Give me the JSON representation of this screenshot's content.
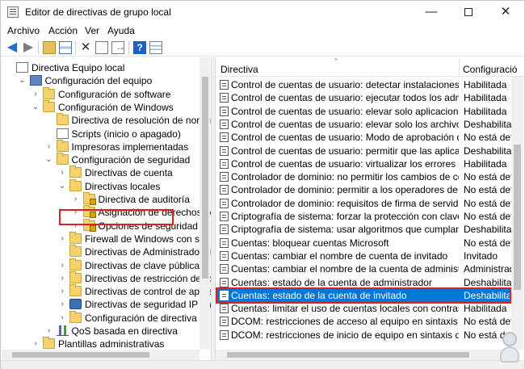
{
  "window": {
    "title": "Editor de directivas de grupo local",
    "controls": {
      "minimize": "—",
      "close": "✕"
    }
  },
  "menu": [
    "Archivo",
    "Acción",
    "Ver",
    "Ayuda"
  ],
  "toolbar": {
    "icons": [
      "back-icon",
      "forward-icon",
      "up-folder-icon",
      "show-hide-tree-icon",
      "delete-icon",
      "properties-icon",
      "export-list-icon",
      "help-icon",
      "filter-view-icon"
    ]
  },
  "tree": {
    "items": [
      {
        "label": "Directiva Equipo local",
        "icon": "document",
        "depth": 0,
        "expander": ""
      },
      {
        "label": "Configuración del equipo",
        "icon": "computer",
        "depth": 1,
        "expander": "open"
      },
      {
        "label": "Configuración de software",
        "icon": "folder",
        "depth": 2,
        "expander": "closed"
      },
      {
        "label": "Configuración de Windows",
        "icon": "folder",
        "depth": 2,
        "expander": "open"
      },
      {
        "label": "Directiva de resolución de nombres",
        "icon": "folder",
        "depth": 3,
        "expander": ""
      },
      {
        "label": "Scripts (inicio o apagado)",
        "icon": "document",
        "depth": 3,
        "expander": ""
      },
      {
        "label": "Impresoras implementadas",
        "icon": "folder",
        "depth": 3,
        "expander": "closed"
      },
      {
        "label": "Configuración de seguridad",
        "icon": "folder",
        "depth": 3,
        "expander": "open"
      },
      {
        "label": "Directivas de cuenta",
        "icon": "folder",
        "depth": 4,
        "expander": "closed"
      },
      {
        "label": "Directivas locales",
        "icon": "folder",
        "depth": 4,
        "expander": "open"
      },
      {
        "label": "Directiva de auditoría",
        "icon": "folder-lock",
        "depth": 5,
        "expander": "closed"
      },
      {
        "label": "Asignación de derechos de usu",
        "icon": "folder-lock",
        "depth": 5,
        "expander": "closed"
      },
      {
        "label": "Opciones de seguridad",
        "icon": "folder-lock",
        "depth": 5,
        "expander": "closed",
        "highlighted": true
      },
      {
        "label": "Firewall de Windows con segurida",
        "icon": "folder",
        "depth": 4,
        "expander": "closed"
      },
      {
        "label": "Directivas de Administrador de list",
        "icon": "folder",
        "depth": 4,
        "expander": ""
      },
      {
        "label": "Directivas de clave pública",
        "icon": "folder",
        "depth": 4,
        "expander": "closed"
      },
      {
        "label": "Directivas de restricción de softwa",
        "icon": "folder",
        "depth": 4,
        "expander": "closed"
      },
      {
        "label": "Directivas de control de aplicacion",
        "icon": "folder",
        "depth": 4,
        "expander": "closed"
      },
      {
        "label": "Directivas de seguridad IP en Equip",
        "icon": "shield",
        "depth": 4,
        "expander": "closed"
      },
      {
        "label": "Configuración de directiva de audi",
        "icon": "folder",
        "depth": 4,
        "expander": "closed"
      },
      {
        "label": "QoS basada en directiva",
        "icon": "chart",
        "depth": 3,
        "expander": "closed"
      },
      {
        "label": "Plantillas administrativas",
        "icon": "folder",
        "depth": 2,
        "expander": "closed"
      }
    ]
  },
  "list": {
    "columns": [
      "Directiva",
      "Configuració"
    ],
    "rows": [
      {
        "policy": "Control de cuentas de usuario: detectar instalaciones de apli...",
        "setting": "Habilitada"
      },
      {
        "policy": "Control de cuentas de usuario: ejecutar todos los administra...",
        "setting": "Habilitada"
      },
      {
        "policy": "Control de cuentas de usuario: elevar solo aplicaciones UIAc...",
        "setting": "Habilitada"
      },
      {
        "policy": "Control de cuentas de usuario: elevar solo los archivos ejecu...",
        "setting": "Deshabilitada"
      },
      {
        "policy": "Control de cuentas de usuario: Modo de aprobación de ad...",
        "setting": "No está defin"
      },
      {
        "policy": "Control de cuentas de usuario: permitir que las aplicaciones ...",
        "setting": "Deshabilitada"
      },
      {
        "policy": "Control de cuentas de usuario: virtualizar los errores de escri...",
        "setting": "Habilitada"
      },
      {
        "policy": "Controlador de dominio: no permitir los cambios de contras...",
        "setting": "No está defin"
      },
      {
        "policy": "Controlador de dominio: permitir a los operadores de servid...",
        "setting": "No está defin"
      },
      {
        "policy": "Controlador de dominio: requisitos de firma de servidor LDAP",
        "setting": "No está defin"
      },
      {
        "policy": "Criptografía de sistema: forzar la protección con claves segu...",
        "setting": "No está defin"
      },
      {
        "policy": "Criptografía de sistema: usar algoritmos que cumplan FIPS ...",
        "setting": "Deshabilitada"
      },
      {
        "policy": "Cuentas: bloquear cuentas Microsoft",
        "setting": "No está defin"
      },
      {
        "policy": "Cuentas: cambiar el nombre de cuenta de invitado",
        "setting": "Invitado"
      },
      {
        "policy": "Cuentas: cambiar el nombre de la cuenta de administrador",
        "setting": "Administrado"
      },
      {
        "policy": "Cuentas: estado de la cuenta de administrador",
        "setting": "Deshabilitada"
      },
      {
        "policy": "Cuentas: estado de la cuenta de invitado",
        "setting": "Deshabilitad",
        "selected": true
      },
      {
        "policy": "Cuentas: limitar el uso de cuentas locales con contraseña en...",
        "setting": "Habilitada"
      },
      {
        "policy": "DCOM: restricciones de acceso al equipo en sintaxis de Leng...",
        "setting": "No está defin"
      },
      {
        "policy": "DCOM: restricciones de inicio de equipo en sintaxis de Leng...",
        "setting": "No está defin"
      }
    ]
  },
  "colors": {
    "selection": "#0078d7",
    "highlight_box": "#e02020"
  }
}
